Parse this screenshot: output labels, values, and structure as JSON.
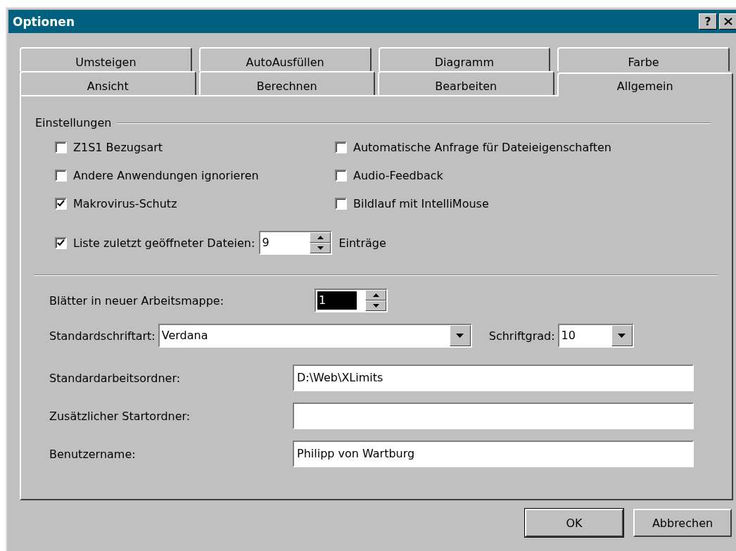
{
  "window": {
    "title": "Optionen",
    "help_button": "?"
  },
  "tab_rows": [
    [
      {
        "label": "Umsteigen",
        "selected": false
      },
      {
        "label": "AutoAusfüllen",
        "selected": false
      },
      {
        "label": "Diagramm",
        "selected": false
      },
      {
        "label": "Farbe",
        "selected": false
      }
    ],
    [
      {
        "label": "Ansicht",
        "selected": false
      },
      {
        "label": "Berechnen",
        "selected": false
      },
      {
        "label": "Bearbeiten",
        "selected": false
      },
      {
        "label": "Allgemein",
        "selected": true
      }
    ]
  ],
  "settings": {
    "title": "Einstellungen",
    "checkboxes": [
      {
        "label": "Z1S1 Bezugsart",
        "checked": false
      },
      {
        "label": "Automatische Anfrage für Dateieigenschaften",
        "checked": false
      },
      {
        "label": "Andere Anwendungen ignorieren",
        "checked": false
      },
      {
        "label": "Audio-Feedback",
        "checked": false
      },
      {
        "label": "Makrovirus-Schutz",
        "checked": true
      },
      {
        "label": "Bildlauf mit IntelliMouse",
        "checked": false
      }
    ],
    "recent_files": {
      "label": "Liste zuletzt geöffneter Dateien:",
      "checked": true,
      "value": "9",
      "suffix": "Einträge"
    }
  },
  "sheets": {
    "label": "Blätter in neuer Arbeitsmappe:",
    "value": "1",
    "value_selected": true
  },
  "font": {
    "label": "Standardschriftart:",
    "value": "Verdana"
  },
  "font_size": {
    "label": "Schriftgrad:",
    "value": "10"
  },
  "paths": [
    {
      "label": "Standardarbeitsordner:",
      "value": "D:\\Web\\XLimits"
    },
    {
      "label": "Zusätzlicher Startordner:"
    },
    {
      "label": "Benutzername:",
      "value": "Philipp von Wartburg"
    }
  ],
  "buttons": [
    {
      "label": "OK",
      "default": true
    },
    {
      "label": "Abbrechen",
      "default": false
    }
  ]
}
